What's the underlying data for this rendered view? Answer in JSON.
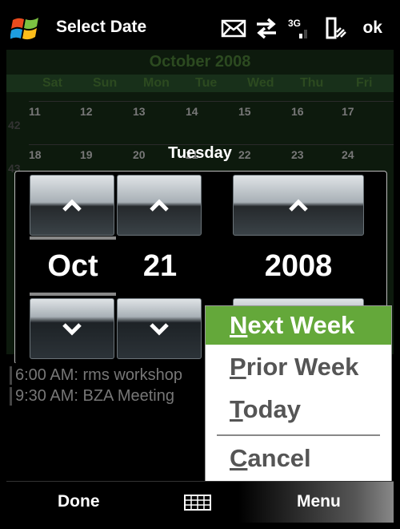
{
  "window": {
    "title": "Select Date",
    "ok_label": "ok",
    "status_icons": [
      "envelope-icon",
      "data-arrows-icon",
      "3g-signal-icon",
      "phone-icon"
    ]
  },
  "calendar": {
    "month": "October 2008",
    "weekdays": [
      "Sat",
      "Sun",
      "Mon",
      "Tue",
      "Wed",
      "Thu",
      "Fri"
    ],
    "week_numbers": [
      "42",
      "43"
    ],
    "rows": [
      [
        "11",
        "12",
        "13",
        "14",
        "15",
        "16",
        "17"
      ],
      [
        "18",
        "19",
        "20",
        "21",
        "22",
        "23",
        "24"
      ]
    ]
  },
  "picker": {
    "weekday_label": "Tuesday",
    "month": "Oct",
    "day": "21",
    "year": "2008"
  },
  "agenda": [
    "6:00 AM: rms workshop",
    "9:30 AM: BZA Meeting"
  ],
  "menu": {
    "items": [
      {
        "mnemonic": "N",
        "rest": "ext Week",
        "selected": true
      },
      {
        "mnemonic": "P",
        "rest": "rior Week",
        "selected": false
      },
      {
        "mnemonic": "T",
        "rest": "oday",
        "selected": false
      },
      {
        "mnemonic": "C",
        "rest": "ancel",
        "selected": false
      }
    ]
  },
  "softkeys": {
    "left": "Done",
    "center_icon": "keyboard-icon",
    "right": "Menu"
  },
  "colors": {
    "menu_highlight": "#64a83a"
  }
}
